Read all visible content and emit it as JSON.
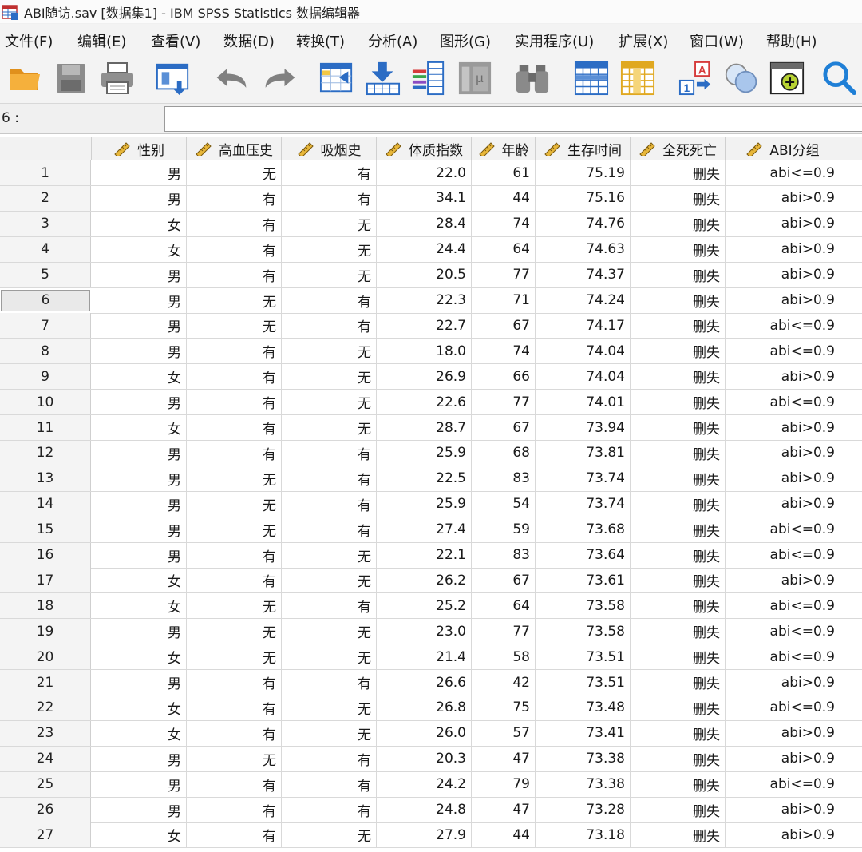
{
  "window": {
    "title": "ABI随访.sav [数据集1] - IBM SPSS Statistics 数据编辑器"
  },
  "menu": [
    "文件(F)",
    "编辑(E)",
    "查看(V)",
    "数据(D)",
    "转换(T)",
    "分析(A)",
    "图形(G)",
    "实用程序(U)",
    "扩展(X)",
    "窗口(W)",
    "帮助(H)"
  ],
  "toolbar": [
    {
      "icon": "open-folder-icon"
    },
    {
      "icon": "save-icon"
    },
    {
      "icon": "print-icon"
    },
    {
      "icon": "recall-dialog-icon"
    },
    {
      "icon": "undo-icon"
    },
    {
      "icon": "redo-icon"
    },
    {
      "icon": "go-to-case-icon"
    },
    {
      "icon": "go-to-variable-icon"
    },
    {
      "icon": "variables-icon"
    },
    {
      "icon": "run-descriptives-icon"
    },
    {
      "icon": "find-icon"
    },
    {
      "icon": "insert-cases-icon"
    },
    {
      "icon": "insert-variable-icon"
    },
    {
      "icon": "value-labels-icon"
    },
    {
      "icon": "use-sets-icon"
    },
    {
      "icon": "show-all-variables-icon"
    },
    {
      "icon": "search-icon"
    }
  ],
  "cell_editor": {
    "ref": "6 :",
    "value": ""
  },
  "columns": [
    "性别",
    "高血压史",
    "吸烟史",
    "体质指数",
    "年龄",
    "生存时间",
    "全死死亡",
    "ABI分组"
  ],
  "rows": [
    [
      "1",
      "男",
      "无",
      "有",
      "22.0",
      "61",
      "75.19",
      "删失",
      "abi<=0.9"
    ],
    [
      "2",
      "男",
      "有",
      "有",
      "34.1",
      "44",
      "75.16",
      "删失",
      "abi>0.9"
    ],
    [
      "3",
      "女",
      "有",
      "无",
      "28.4",
      "74",
      "74.76",
      "删失",
      "abi>0.9"
    ],
    [
      "4",
      "女",
      "有",
      "无",
      "24.4",
      "64",
      "74.63",
      "删失",
      "abi>0.9"
    ],
    [
      "5",
      "男",
      "有",
      "无",
      "20.5",
      "77",
      "74.37",
      "删失",
      "abi>0.9"
    ],
    [
      "6",
      "男",
      "无",
      "有",
      "22.3",
      "71",
      "74.24",
      "删失",
      "abi>0.9"
    ],
    [
      "7",
      "男",
      "无",
      "有",
      "22.7",
      "67",
      "74.17",
      "删失",
      "abi<=0.9"
    ],
    [
      "8",
      "男",
      "有",
      "无",
      "18.0",
      "74",
      "74.04",
      "删失",
      "abi<=0.9"
    ],
    [
      "9",
      "女",
      "有",
      "无",
      "26.9",
      "66",
      "74.04",
      "删失",
      "abi>0.9"
    ],
    [
      "10",
      "男",
      "有",
      "无",
      "22.6",
      "77",
      "74.01",
      "删失",
      "abi<=0.9"
    ],
    [
      "11",
      "女",
      "有",
      "无",
      "28.7",
      "67",
      "73.94",
      "删失",
      "abi>0.9"
    ],
    [
      "12",
      "男",
      "有",
      "有",
      "25.9",
      "68",
      "73.81",
      "删失",
      "abi>0.9"
    ],
    [
      "13",
      "男",
      "无",
      "有",
      "22.5",
      "83",
      "73.74",
      "删失",
      "abi>0.9"
    ],
    [
      "14",
      "男",
      "无",
      "有",
      "25.9",
      "54",
      "73.74",
      "删失",
      "abi>0.9"
    ],
    [
      "15",
      "男",
      "无",
      "有",
      "27.4",
      "59",
      "73.68",
      "删失",
      "abi<=0.9"
    ],
    [
      "16",
      "男",
      "有",
      "无",
      "22.1",
      "83",
      "73.64",
      "删失",
      "abi<=0.9"
    ],
    [
      "17",
      "女",
      "有",
      "无",
      "26.2",
      "67",
      "73.61",
      "删失",
      "abi>0.9"
    ],
    [
      "18",
      "女",
      "无",
      "有",
      "25.2",
      "64",
      "73.58",
      "删失",
      "abi<=0.9"
    ],
    [
      "19",
      "男",
      "无",
      "无",
      "23.0",
      "77",
      "73.58",
      "删失",
      "abi<=0.9"
    ],
    [
      "20",
      "女",
      "无",
      "无",
      "21.4",
      "58",
      "73.51",
      "删失",
      "abi<=0.9"
    ],
    [
      "21",
      "男",
      "有",
      "有",
      "26.6",
      "42",
      "73.51",
      "删失",
      "abi>0.9"
    ],
    [
      "22",
      "女",
      "有",
      "无",
      "26.8",
      "75",
      "73.48",
      "删失",
      "abi<=0.9"
    ],
    [
      "23",
      "女",
      "有",
      "无",
      "26.0",
      "57",
      "73.41",
      "删失",
      "abi>0.9"
    ],
    [
      "24",
      "男",
      "无",
      "有",
      "20.3",
      "47",
      "73.38",
      "删失",
      "abi>0.9"
    ],
    [
      "25",
      "男",
      "有",
      "有",
      "24.2",
      "79",
      "73.38",
      "删失",
      "abi<=0.9"
    ],
    [
      "26",
      "男",
      "有",
      "有",
      "24.8",
      "47",
      "73.28",
      "删失",
      "abi>0.9"
    ],
    [
      "27",
      "女",
      "有",
      "无",
      "27.9",
      "44",
      "73.18",
      "删失",
      "abi>0.9"
    ]
  ],
  "selected_row": "6",
  "colors": {
    "accent_blue": "#2b6cc4",
    "folder_orange": "#f2a530",
    "ruler_yellow": "#e8b73a"
  }
}
